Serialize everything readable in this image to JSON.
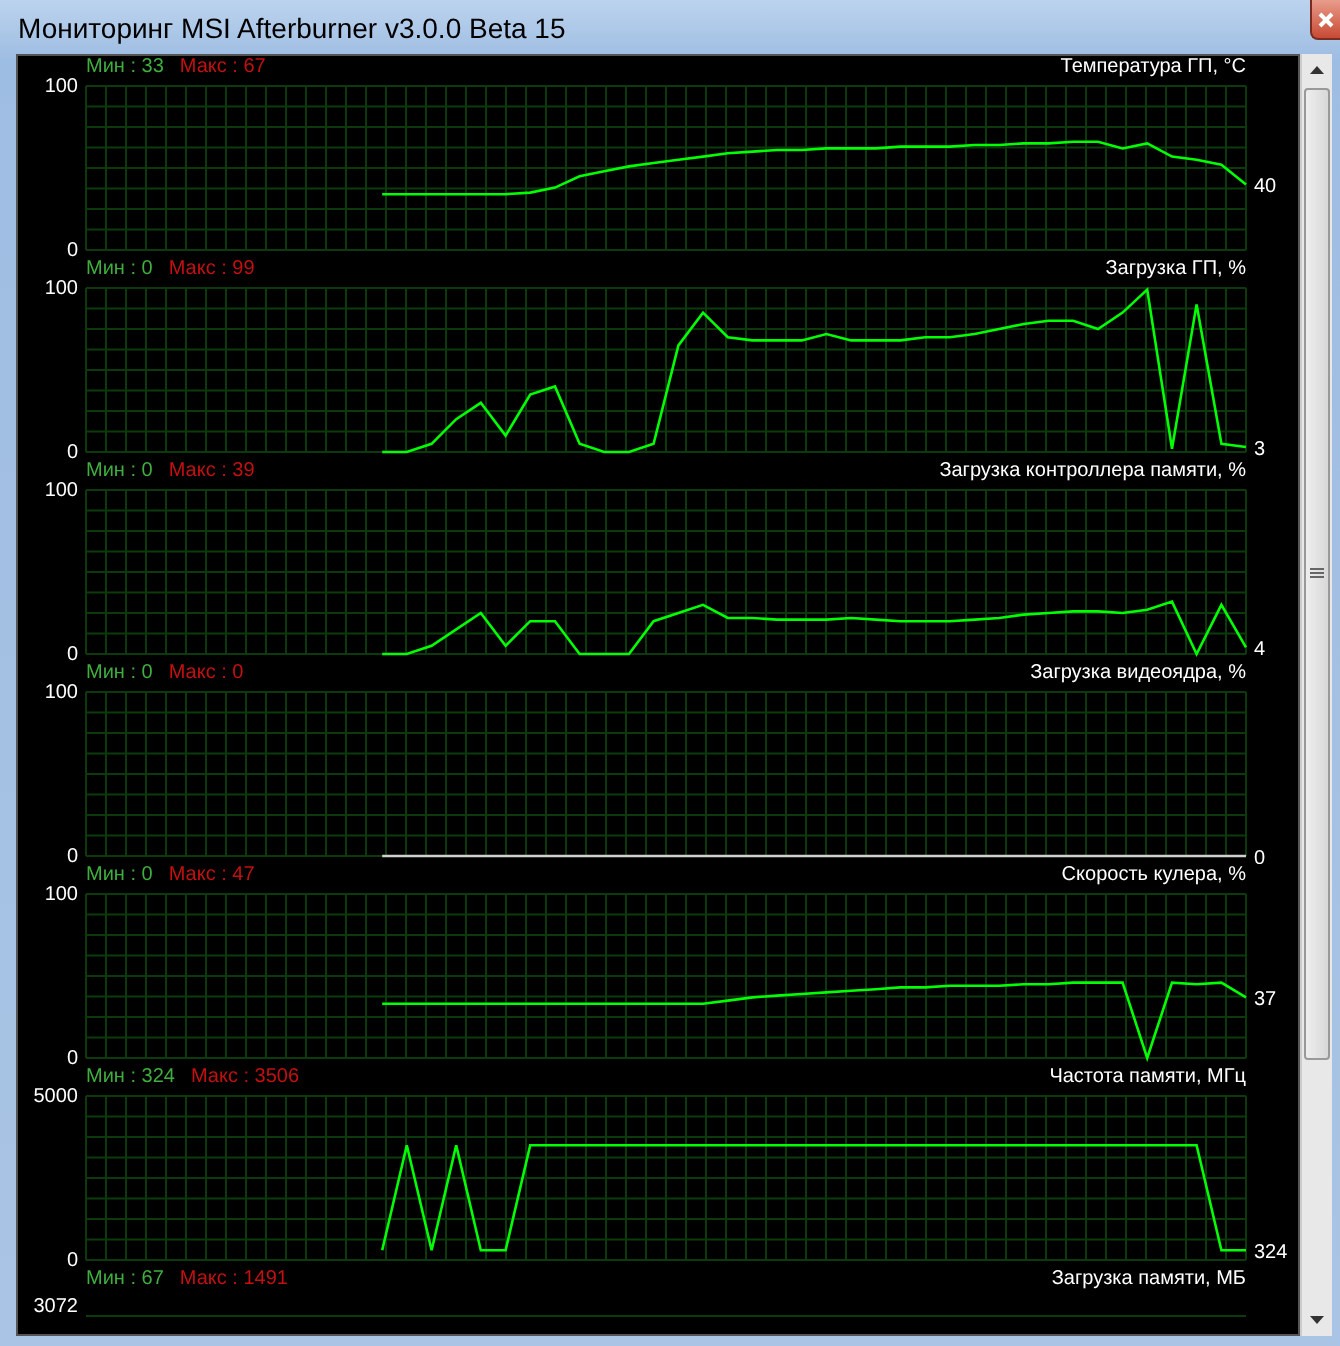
{
  "window": {
    "title": "Мониторинг MSI Afterburner v3.0.0 Beta 15"
  },
  "graphs": [
    {
      "min_label": "Мин : 33",
      "max_label": "Макс : 67",
      "title": "Температура ГП, °C",
      "current": "40",
      "chart_data": {
        "type": "line",
        "grid": true,
        "ylim": [
          0,
          100
        ],
        "yticks": [
          0,
          100
        ],
        "series": [
          {
            "color": "#00ff00",
            "values": [
              null,
              null,
              null,
              null,
              null,
              null,
              null,
              null,
              null,
              null,
              null,
              null,
              34,
              34,
              34,
              34,
              34,
              34,
              35,
              38,
              45,
              48,
              51,
              53,
              55,
              57,
              59,
              60,
              61,
              61,
              62,
              62,
              62,
              63,
              63,
              63,
              64,
              64,
              65,
              65,
              66,
              66,
              62,
              65,
              57,
              55,
              52,
              40
            ]
          }
        ]
      }
    },
    {
      "min_label": "Мин : 0",
      "max_label": "Макс : 99",
      "title": "Загрузка ГП, %",
      "current": "3",
      "chart_data": {
        "type": "line",
        "grid": true,
        "ylim": [
          0,
          100
        ],
        "yticks": [
          0,
          100
        ],
        "series": [
          {
            "color": "#00ff00",
            "values": [
              null,
              null,
              null,
              null,
              null,
              null,
              null,
              null,
              null,
              null,
              null,
              null,
              0,
              0,
              5,
              20,
              30,
              10,
              35,
              40,
              5,
              0,
              0,
              5,
              65,
              85,
              70,
              68,
              68,
              68,
              72,
              68,
              68,
              68,
              70,
              70,
              72,
              75,
              78,
              80,
              80,
              75,
              85,
              99,
              2,
              90,
              5,
              3
            ]
          }
        ]
      }
    },
    {
      "min_label": "Мин : 0",
      "max_label": "Макс : 39",
      "title": "Загрузка контроллера памяти, %",
      "current": "4",
      "chart_data": {
        "type": "line",
        "grid": true,
        "ylim": [
          0,
          100
        ],
        "yticks": [
          0,
          100
        ],
        "series": [
          {
            "color": "#00ff00",
            "values": [
              null,
              null,
              null,
              null,
              null,
              null,
              null,
              null,
              null,
              null,
              null,
              null,
              0,
              0,
              5,
              15,
              25,
              5,
              20,
              20,
              0,
              0,
              0,
              20,
              25,
              30,
              22,
              22,
              21,
              21,
              21,
              22,
              21,
              20,
              20,
              20,
              21,
              22,
              24,
              25,
              26,
              26,
              25,
              27,
              32,
              0,
              30,
              4
            ]
          }
        ]
      }
    },
    {
      "min_label": "Мин : 0",
      "max_label": "Макс : 0",
      "title": "Загрузка видеоядра, %",
      "current": "0",
      "chart_data": {
        "type": "line",
        "grid": true,
        "ylim": [
          0,
          100
        ],
        "yticks": [
          0,
          100
        ],
        "series": [
          {
            "color": "#d0d0d0",
            "values": [
              null,
              null,
              null,
              null,
              null,
              null,
              null,
              null,
              null,
              null,
              null,
              null,
              0,
              0,
              0,
              0,
              0,
              0,
              0,
              0,
              0,
              0,
              0,
              0,
              0,
              0,
              0,
              0,
              0,
              0,
              0,
              0,
              0,
              0,
              0,
              0,
              0,
              0,
              0,
              0,
              0,
              0,
              0,
              0,
              0,
              0,
              0,
              0
            ]
          }
        ]
      }
    },
    {
      "min_label": "Мин : 0",
      "max_label": "Макс : 47",
      "title": "Скорость кулера, %",
      "current": "37",
      "chart_data": {
        "type": "line",
        "grid": true,
        "ylim": [
          0,
          100
        ],
        "yticks": [
          0,
          100
        ],
        "series": [
          {
            "color": "#00ff00",
            "values": [
              null,
              null,
              null,
              null,
              null,
              null,
              null,
              null,
              null,
              null,
              null,
              null,
              33,
              33,
              33,
              33,
              33,
              33,
              33,
              33,
              33,
              33,
              33,
              33,
              33,
              33,
              35,
              37,
              38,
              39,
              40,
              41,
              42,
              43,
              43,
              44,
              44,
              44,
              45,
              45,
              46,
              46,
              46,
              0,
              46,
              45,
              46,
              37
            ]
          }
        ]
      }
    },
    {
      "min_label": "Мин : 324",
      "max_label": "Макс : 3506",
      "title": "Частота памяти, МГц",
      "current": "324",
      "chart_data": {
        "type": "line",
        "grid": true,
        "ylim": [
          0,
          5000
        ],
        "yticks": [
          0,
          5000
        ],
        "series": [
          {
            "color": "#00ff00",
            "values": [
              null,
              null,
              null,
              null,
              null,
              null,
              null,
              null,
              null,
              null,
              null,
              null,
              300,
              3500,
              300,
              3500,
              300,
              300,
              3500,
              3500,
              3500,
              3500,
              3500,
              3500,
              3500,
              3500,
              3500,
              3500,
              3500,
              3500,
              3500,
              3500,
              3500,
              3500,
              3500,
              3500,
              3500,
              3500,
              3500,
              3500,
              3500,
              3500,
              3500,
              3500,
              3500,
              3500,
              300,
              300
            ]
          }
        ]
      }
    },
    {
      "min_label": "Мин : 67",
      "max_label": "Макс : 1491",
      "title": "Загрузка памяти, МБ",
      "top_tick": "3072"
    }
  ]
}
